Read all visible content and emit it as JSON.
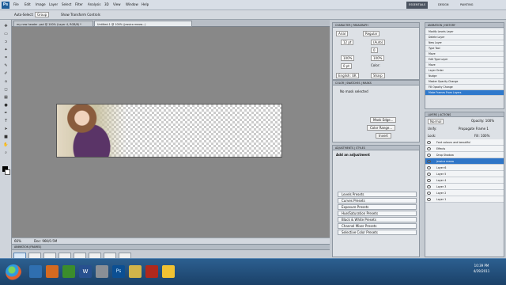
{
  "app": {
    "logo": "Ps"
  },
  "menu": [
    "File",
    "Edit",
    "Image",
    "Layer",
    "Select",
    "Filter",
    "Analysis",
    "3D",
    "View",
    "Window",
    "Help"
  ],
  "workspace": [
    "ESSENTIALS",
    "DESIGN",
    "PAINTING"
  ],
  "options": {
    "auto_select": "Auto-Select:",
    "group": "Group",
    "transform": "Show Transform Controls"
  },
  "tabs": [
    "my new header .psd @ 100% (Layer 4, RGB/8) *",
    "Untitled-1 @ 100% (jessica meow...)"
  ],
  "status": {
    "zoom": "66%",
    "doc": "Doc: 96K/0.5M"
  },
  "history": {
    "items": [
      "Modify Levels Layer",
      "Delete Layer",
      "New Layer",
      "Type Tool",
      "Move",
      "Edit Type Layer",
      "Move",
      "Layer Order",
      "Nudge",
      "Master Opacity Change",
      "Fill Opacity Change",
      "Make Frames From Layers"
    ],
    "selected_index": 11
  },
  "character": {
    "font": "Arial",
    "style": "Regular",
    "size": "12 pt",
    "leading": "(Auto)",
    "tracking": "0",
    "scale_v": "100%",
    "scale_h": "100%",
    "baseline": "0 pt",
    "color": "Color:",
    "lang": "English: UK",
    "aa": "Sharp"
  },
  "masks": {
    "note": "No mask selected",
    "buttons": [
      "Mask Edge...",
      "Color Range...",
      "Invert"
    ]
  },
  "adjustments": {
    "title": "Add an adjustment",
    "presets": [
      "Levels Presets",
      "Curves Presets",
      "Exposure Presets",
      "Hue/Saturation Presets",
      "Black & White Presets",
      "Channel Mixer Presets",
      "Selective Color Presets"
    ]
  },
  "layers": {
    "blend": "Normal",
    "opacity": "Opacity: 100%",
    "unify": "Unify:",
    "propagate": "Propagate Frame 1",
    "lock": "Lock:",
    "fill": "Fill: 100%",
    "rows": [
      "Font colours and beautiful",
      "Effects",
      "Drop Shadow",
      "jessica meow",
      "Layer 6",
      "Layer 5",
      "Layer 4",
      "Layer 3",
      "Layer 2",
      "Layer 1"
    ],
    "selected_index": 3
  },
  "animation": {
    "title": "ANIMATION (FRAMES)",
    "frames": [
      "0 sec.",
      "0 sec.",
      "0 sec.",
      "0 sec.",
      "0 sec.",
      "0 sec.",
      "0 sec.",
      "0 sec."
    ],
    "loop": "Forever"
  },
  "clock": {
    "time": "10:39 PM",
    "date": "4/29/2011"
  },
  "colors": {
    "accent": "#2f79cc",
    "taskbar": "#1b4168"
  }
}
